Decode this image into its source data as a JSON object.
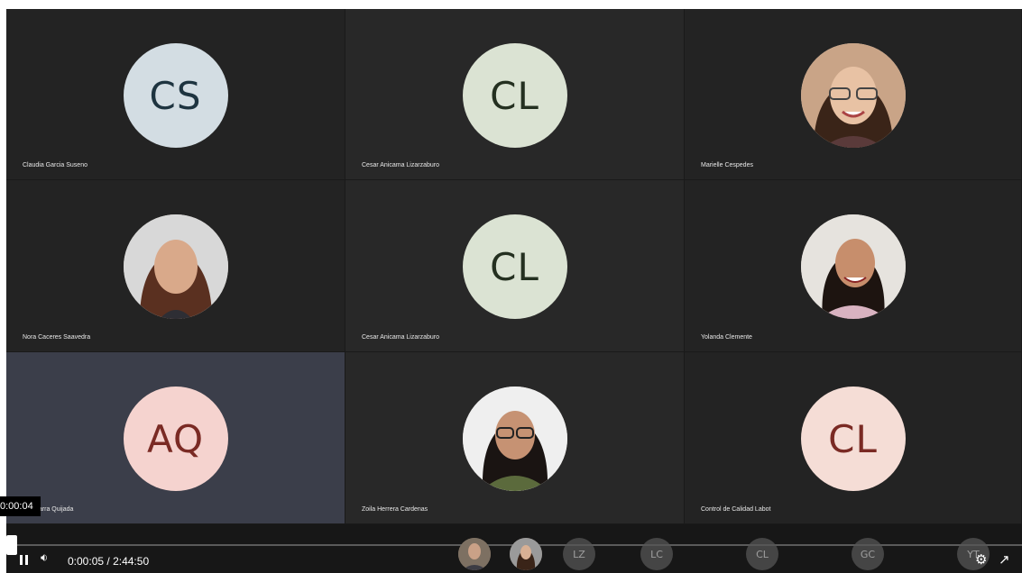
{
  "participants": [
    {
      "initials": "CS",
      "name": "Claudia Garcia Suseno",
      "avatar_bg": "#d3dde3",
      "avatar_fg": "#1e3440",
      "photo": false
    },
    {
      "initials": "CL",
      "name": "Cesar Anicama Lizarzaburo",
      "avatar_bg": "#dbe3d3",
      "avatar_fg": "#243020",
      "photo": false
    },
    {
      "initials": "",
      "name": "Marielle Cespedes",
      "photo": true
    },
    {
      "initials": "",
      "name": "Nora Caceres Saavedra",
      "photo": true
    },
    {
      "initials": "CL",
      "name": "Cesar Anicama Lizarzaburo",
      "avatar_bg": "#dbe3d3",
      "avatar_fg": "#243020",
      "photo": false
    },
    {
      "initials": "",
      "name": "Yolanda Clemente",
      "photo": true
    },
    {
      "initials": "AQ",
      "name": "a Zegarra Quijada",
      "avatar_bg": "#f5d3cf",
      "avatar_fg": "#7a2a24",
      "photo": false
    },
    {
      "initials": "",
      "name": "Zoila Herrera Cardenas",
      "photo": true
    },
    {
      "initials": "CL",
      "name": "Control de Calidad Labot",
      "avatar_bg": "#f5ddd6",
      "avatar_fg": "#7a2a24",
      "photo": false
    }
  ],
  "player": {
    "tooltip_time": "0:00:04",
    "current_time": "0:00:05",
    "separator": "/",
    "total_time": "2:44:50",
    "progress": 0.0005
  },
  "thumbnail_strip": [
    {
      "initials": "",
      "photo": true
    },
    {
      "initials": "",
      "photo": true
    },
    {
      "initials": "LZ",
      "photo": false
    },
    {
      "initials": "LC",
      "photo": false
    },
    {
      "initials": "CL",
      "photo": false
    },
    {
      "initials": "GC",
      "photo": false
    },
    {
      "initials": "YT",
      "photo": false
    }
  ],
  "icons": {
    "play_pause": "pause-icon",
    "volume": "volume-icon",
    "settings": "gear-icon",
    "fullscreen": "exit-fullscreen-icon"
  },
  "colors": {
    "stage_bg": "#1e1e1e",
    "active_tile_bg": "#3b3e4a",
    "control_bar_bg": "#171717"
  }
}
